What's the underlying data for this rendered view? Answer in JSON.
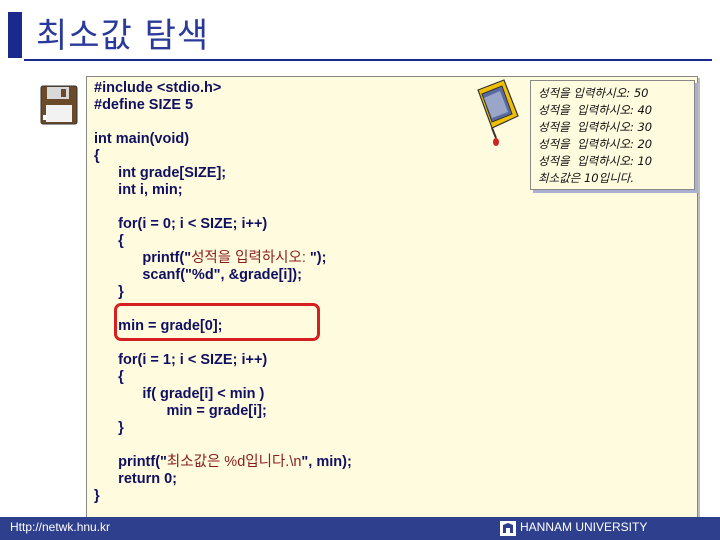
{
  "slide": {
    "title": "최소값 탐색"
  },
  "code": {
    "lines": [
      "#include <stdio.h>",
      "#define SIZE 5",
      "",
      "int main(void)",
      "{",
      "      int grade[SIZE];",
      "      int i, min;",
      "",
      "      for(i = 0; i < SIZE; i++)",
      "      {",
      "            printf(\"성적을 입력하시오: \");",
      "            scanf(\"%d\", &grade[i]);",
      "      }",
      "",
      "      min = grade[0];",
      "",
      "      for(i = 1; i < SIZE; i++)",
      "      {",
      "            if( grade[i] < min )",
      "                  min = grade[i];",
      "      }",
      "",
      "      printf(\"최소값은 %d입니다.\\n\", min);",
      "      return 0;",
      "}"
    ]
  },
  "output": {
    "lines": [
      "성적을 입력하시오: 50",
      "성적을  입력하시오: 40",
      "성적을  입력하시오: 30",
      "성적을  입력하시오: 20",
      "성적을  입력하시오: 10",
      "최소값은 10입니다."
    ]
  },
  "footer": {
    "url": "Http://netwk.hnu.kr",
    "university": "HANNAM  UNIVERSITY"
  },
  "colors": {
    "accent": "#2e3f8e",
    "highlight": "#d42020",
    "panel_bg": "#fffbdf"
  },
  "icons": {
    "left": "floppy-disk-icon",
    "right": "mouse-icon",
    "footer": "university-logo-icon"
  }
}
